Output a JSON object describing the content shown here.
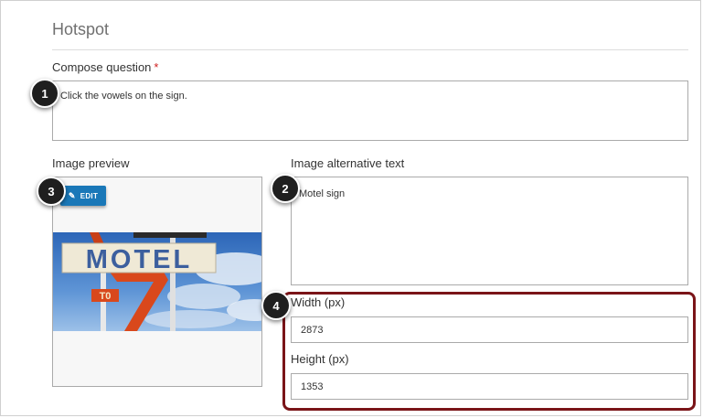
{
  "section": {
    "title": "Hotspot"
  },
  "question": {
    "label": "Compose question",
    "required_mark": "*",
    "value": "Click the vowels on the sign."
  },
  "preview": {
    "label": "Image preview",
    "edit_label": "EDIT",
    "sign_text": "MOTEL",
    "small_sign": "T0"
  },
  "alt_text": {
    "label": "Image alternative text",
    "value": "Motel sign"
  },
  "dimensions": {
    "width_label": "Width (px)",
    "width_value": "2873",
    "height_label": "Height (px)",
    "height_value": "1353",
    "highlight_color": "#7a1418"
  },
  "callouts": [
    "1",
    "2",
    "3",
    "4"
  ],
  "colors": {
    "accent": "#1a78b8",
    "callout": "#1f1f1f"
  }
}
